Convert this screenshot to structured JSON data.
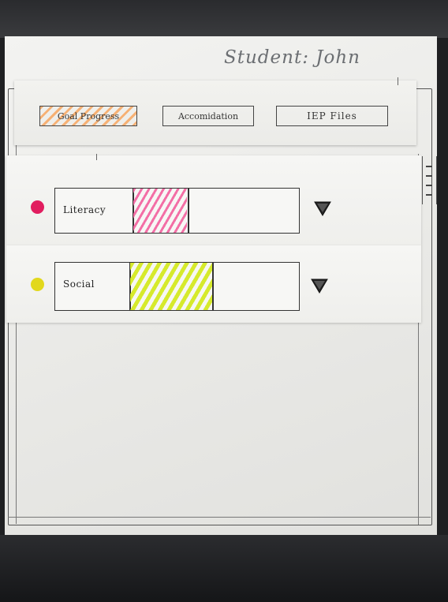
{
  "header": {
    "student_title": "Student: John"
  },
  "tabs": [
    {
      "id": "goal-progress",
      "label": "Goal Progress",
      "selected": true
    },
    {
      "id": "accomodation",
      "label": "Accomidation",
      "selected": false
    },
    {
      "id": "iep-files",
      "label": "IEP Files",
      "selected": false
    }
  ],
  "goals": [
    {
      "label": "Literacy",
      "color": "#e11d5f",
      "progress": 0.22
    },
    {
      "label": "Social",
      "color": "#e2d81c",
      "progress": 0.34
    }
  ],
  "icons": {
    "expand": "triangle-down-icon",
    "status": "colored-dot-icon"
  }
}
